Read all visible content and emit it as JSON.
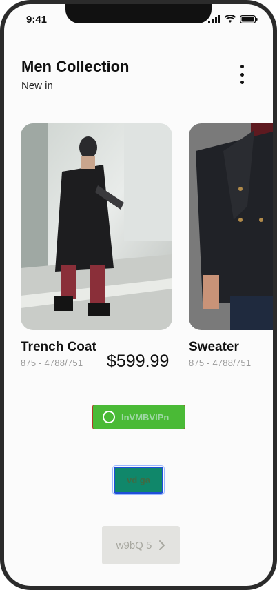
{
  "status": {
    "time": "9:41"
  },
  "header": {
    "title": "Men Collection",
    "subtitle": "New in"
  },
  "products": [
    {
      "name": "Trench Coat",
      "sku": "875 - 4788/751",
      "price": "$599.99"
    },
    {
      "name": "Sweater",
      "sku": "875 - 4788/751"
    }
  ],
  "buttons": {
    "green_label": "lnVMBVlPn",
    "teal_label": "vd ga",
    "grey_label": "w9bQ 5"
  },
  "icons": {
    "menu": "more-vertical-icon",
    "green": "circle-icon",
    "grey": "chevron-right-icon"
  },
  "colors": {
    "green_button": "#4aba36",
    "teal_button": "#10876a",
    "grey_button": "#e3e3e0"
  }
}
